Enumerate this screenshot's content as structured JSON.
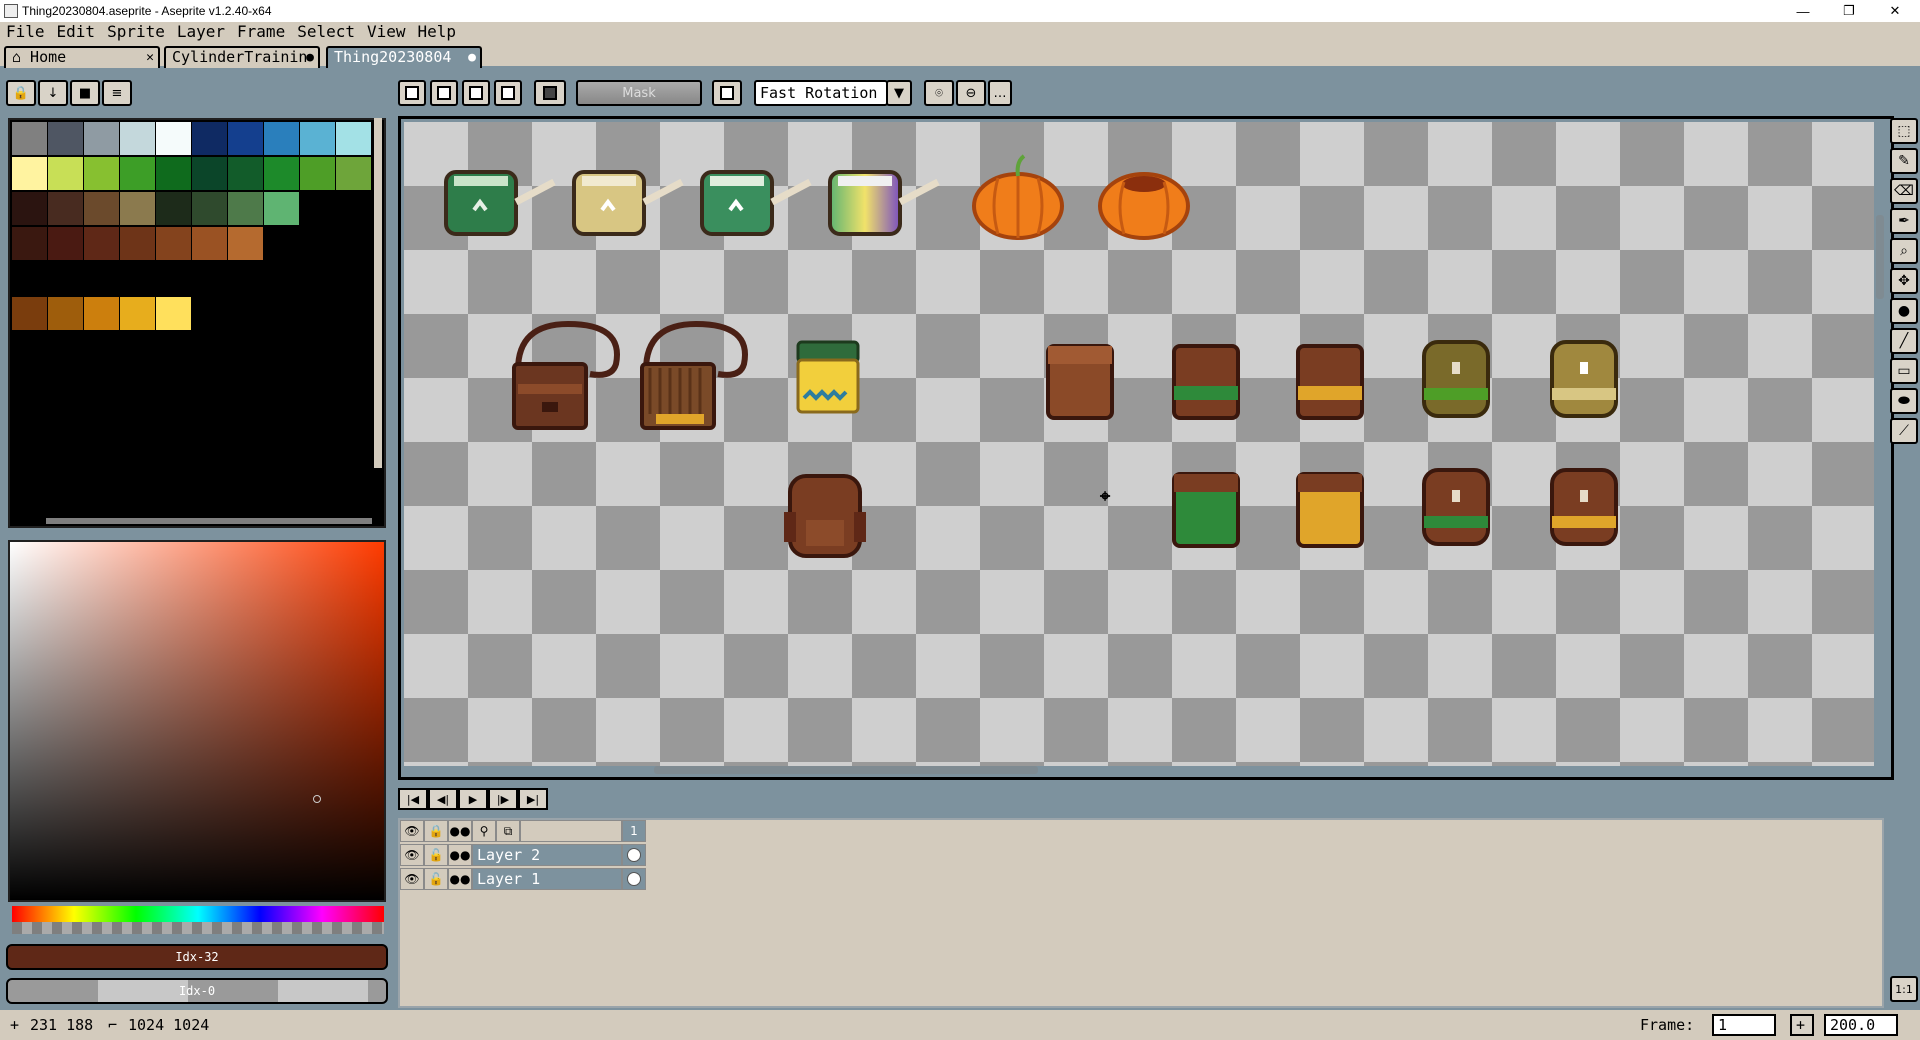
{
  "window": {
    "title": "Thing20230804.aseprite - Aseprite v1.2.40-x64",
    "min": "—",
    "max": "❐",
    "close": "✕"
  },
  "menu": [
    "File",
    "Edit",
    "Sprite",
    "Layer",
    "Frame",
    "Select",
    "View",
    "Help"
  ],
  "tabs": [
    {
      "label": "⌂ Home",
      "close": "✕"
    },
    {
      "label": "CylinderTrainin",
      "close": "●"
    },
    {
      "label": "Thing20230804",
      "close": "●"
    }
  ],
  "toolbar": {
    "mask_label": "Mask",
    "rotation_algorithm": "Fast Rotation"
  },
  "color_bars": {
    "fg": "Idx-32",
    "bg": "Idx-0"
  },
  "palette": {
    "rows": [
      [
        "#808080",
        "#4f5663",
        "#8f9ba3",
        "#c4d8dc",
        "#f5fbfb",
        "#0f2a63",
        "#143f8e",
        "#2a7fbc",
        "#5ab2d3",
        "#a3e1e6"
      ],
      [
        "#fff3a0",
        "#c8df56",
        "#87c030",
        "#3d9e27",
        "#0f6b1d",
        "#0b4529",
        "#125c2a",
        "#1d8a2a",
        "#4e9e27",
        "#6ea53a"
      ],
      [
        "#2b1410",
        "#482b20",
        "#6b4a2c",
        "#8b7a4e",
        "#1d2b1a",
        "#2f4a2d",
        "#4e7a4a",
        "#5fb472"
      ],
      [
        "#3a1810",
        "#4a1a12",
        "#5f2817",
        "#6e3418",
        "#84431d",
        "#9a5223",
        "#b56a2f"
      ],
      [],
      [
        "#7a3d0d",
        "#9e5d0c",
        "#cc7f0d",
        "#e7ad1d",
        "#ffe05c"
      ]
    ]
  },
  "timeline": {
    "frame_header": "1",
    "layers": [
      {
        "name": "Layer 2"
      },
      {
        "name": "Layer 1"
      }
    ]
  },
  "status": {
    "coords": "231 188",
    "size": "1024 1024",
    "frame_label": "Frame:",
    "frame_value": "1",
    "zoom": "200.0",
    "plus": "+"
  }
}
